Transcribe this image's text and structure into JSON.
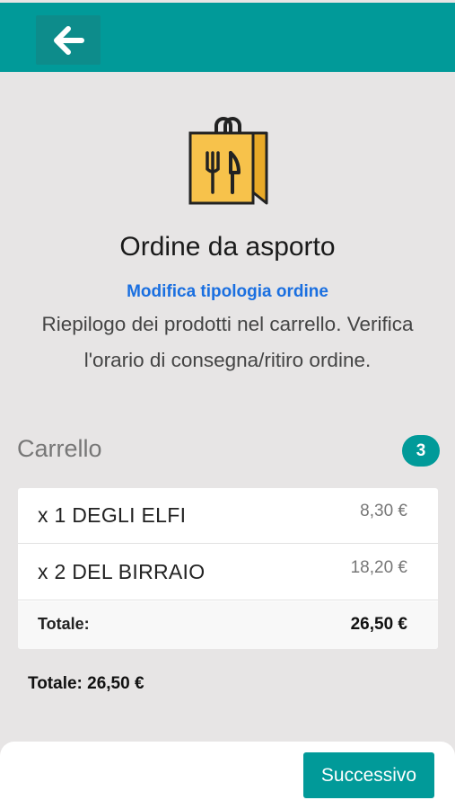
{
  "header": {
    "back_icon": "arrow-left-icon",
    "bar_color": "#019a99"
  },
  "order": {
    "icon": "takeaway-bag-icon",
    "title": "Ordine da asporto",
    "modify_link": "Modifica tipologia ordine",
    "description": "Riepilogo dei prodotti nel carrello. Verifica l'orario di consegna/ritiro ordine."
  },
  "cart": {
    "title": "Carrello",
    "count": "3",
    "items": [
      {
        "name": "x 1 DEGLI ELFI",
        "price": "8,30 €"
      },
      {
        "name": "x 2 DEL BIRRAIO",
        "price": "18,20 €"
      }
    ],
    "total_label": "Totale:",
    "total_value": "26,50 €"
  },
  "summary": {
    "grand_total": "Totale: 26,50 €"
  },
  "footer": {
    "next_label": "Successivo"
  }
}
